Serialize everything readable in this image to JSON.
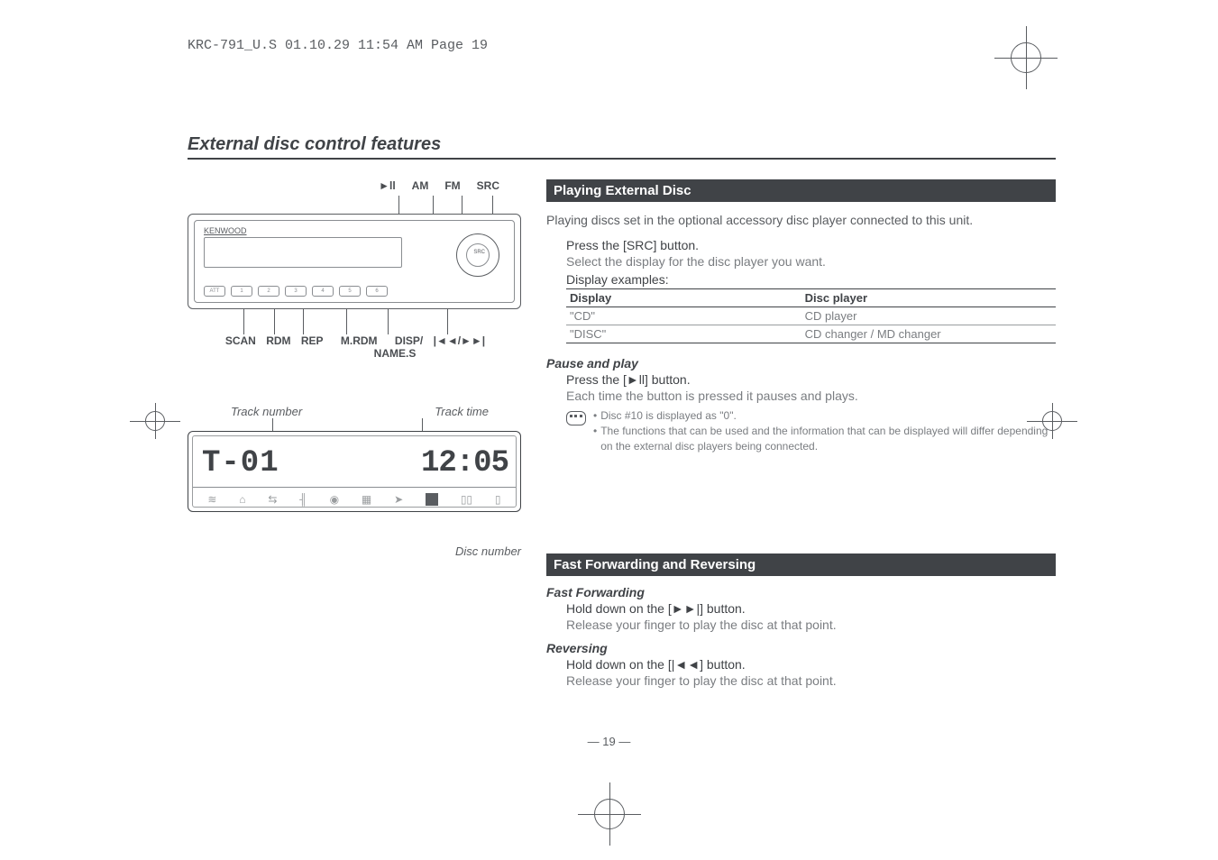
{
  "header_line": "KRC-791_U.S  01.10.29  11:54 AM  Page 19",
  "title": "External disc control features",
  "top_buttons": [
    "►ll",
    "AM",
    "FM",
    "SRC"
  ],
  "faceplate_brand": "KENWOOD",
  "faceplate_src": "SRC",
  "faceplate_tiny_left": "",
  "faceplate_buttons": [
    "ATT",
    "1",
    "2",
    "3",
    "4",
    "5",
    "6"
  ],
  "bottom_labels_line1": [
    "SCAN",
    "RDM",
    "REP",
    "M.RDM",
    "DISP/",
    "|◄◄/►►|"
  ],
  "bottom_labels_line2": "NAME.S",
  "track_number_label": "Track number",
  "track_time_label": "Track time",
  "lcd_left_text": "T-01",
  "lcd_right_text": "12:05",
  "disc_number_label": "Disc number",
  "section1": {
    "header": "Playing External Disc",
    "intro": "Playing discs set in the optional accessory disc player connected to this unit.",
    "step": "Press the [SRC] button.",
    "sub": "Select the display for the disc player you want.",
    "examples_label": "Display examples:",
    "table_headers": [
      "Display",
      "Disc player"
    ],
    "table_rows": [
      [
        "\"CD\"",
        "CD player"
      ],
      [
        "\"DISC\"",
        "CD changer / MD changer"
      ]
    ],
    "pause_head": "Pause and play",
    "pause_step": "Press the [►ll] button.",
    "pause_sub": "Each time the button is pressed it pauses and plays.",
    "notes": [
      "Disc #10 is displayed as \"0\".",
      "The functions that can be used and the information that can be displayed will differ depending on the external disc players being connected."
    ]
  },
  "section2": {
    "header": "Fast Forwarding and Reversing",
    "ff_head": "Fast Forwarding",
    "ff_step": "Hold down on the [►►|] button.",
    "ff_sub": "Release your finger to play the disc at that point.",
    "rev_head": "Reversing",
    "rev_step": "Hold down on the [|◄◄] button.",
    "rev_sub": "Release your finger to play the disc at that point."
  },
  "page_number": "— 19 —"
}
